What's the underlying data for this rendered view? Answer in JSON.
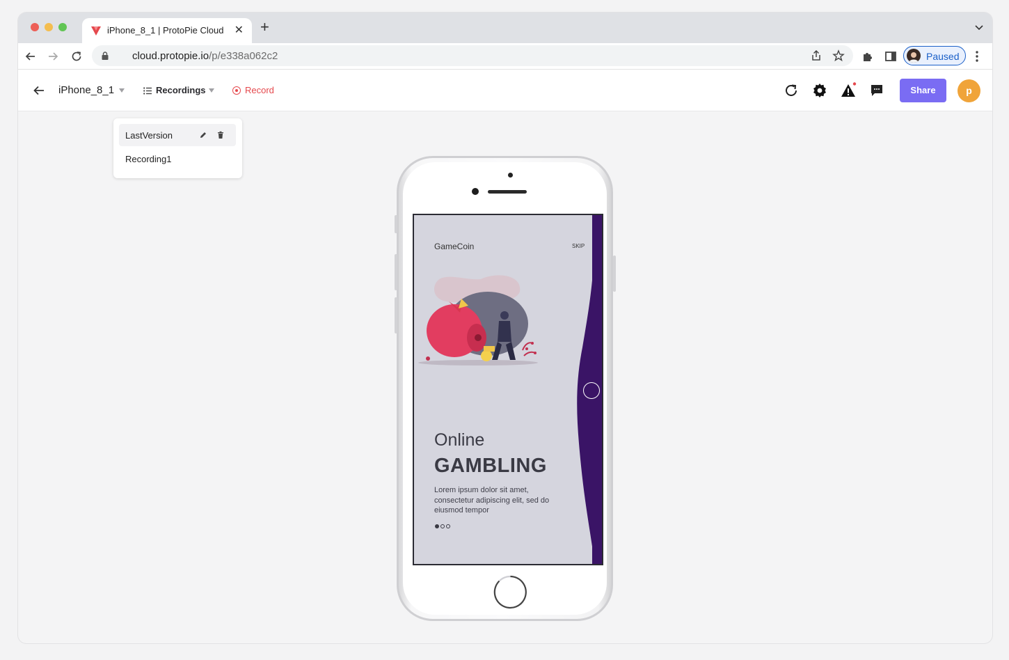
{
  "browser": {
    "tab_title": "iPhone_8_1 | ProtoPie Cloud",
    "tab_close": "✕",
    "new_tab": "+",
    "url_domain": "cloud.protopie.io",
    "url_path": "/p/e338a062c2",
    "profile_status": "Paused",
    "icons": [
      "back-icon",
      "forward-icon",
      "reload-icon",
      "lock-icon",
      "share-page-icon",
      "bookmark-star-icon",
      "extensions-icon",
      "side-panel-icon",
      "menu-kebab-icon",
      "tab-list-chevron-icon"
    ]
  },
  "toolbar": {
    "project_name": "iPhone_8_1",
    "recordings_label": "Recordings",
    "record_label": "Record",
    "share_label": "Share",
    "avatar_initial": "p",
    "accent_color": "#7a6cf3",
    "record_color": "#e5484d",
    "avatar_color": "#f0a43a",
    "icons": [
      "refresh-icon",
      "settings-gear-icon",
      "warning-icon",
      "comment-icon"
    ]
  },
  "recordings_menu": {
    "items": [
      {
        "label": "LastVersion",
        "selected": true,
        "actions": [
          "edit-pencil-icon",
          "trash-icon"
        ]
      },
      {
        "label": "Recording1",
        "selected": false
      }
    ]
  },
  "prototype": {
    "app_name": "GameCoin",
    "skip_label": "SKIP",
    "headline_light": "Online",
    "headline_bold": "GAMBLING",
    "body_text": "Lorem ipsum dolor sit amet, consectetur adipiscing elit, sed do eiusmod tempor",
    "pager_total": 3,
    "pager_active": 1,
    "strip_color": "#3a1466"
  }
}
